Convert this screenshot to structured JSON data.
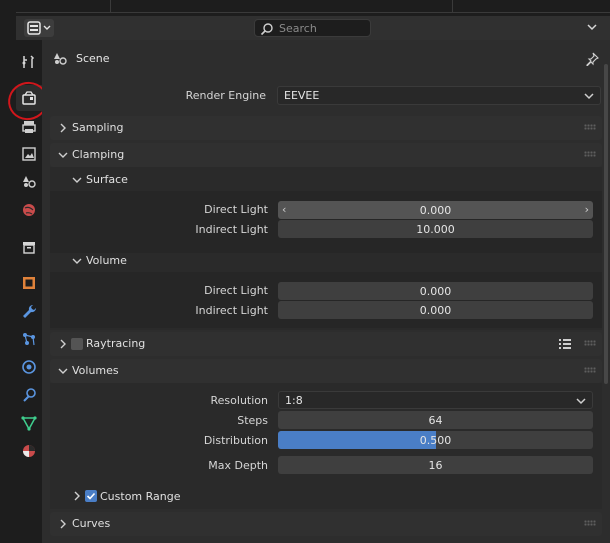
{
  "header": {
    "search_placeholder": "Search",
    "editor_type_icon": "properties-editor-icon"
  },
  "tabs": [
    {
      "name": "tool-icon"
    },
    {
      "name": "render-icon",
      "active": true
    },
    {
      "name": "output-icon"
    },
    {
      "name": "view-layer-icon"
    },
    {
      "name": "scene-icon"
    },
    {
      "name": "world-icon"
    },
    {
      "name": "collection-icon"
    },
    {
      "name": "object-icon"
    },
    {
      "name": "modifier-icon"
    },
    {
      "name": "particles-icon"
    },
    {
      "name": "physics-icon"
    },
    {
      "name": "constraints-icon"
    },
    {
      "name": "data-icon"
    },
    {
      "name": "material-icon"
    }
  ],
  "breadcrumb": {
    "scene": "Scene"
  },
  "render_engine": {
    "label": "Render Engine",
    "value": "EEVEE"
  },
  "panels": {
    "sampling": "Sampling",
    "clamping": "Clamping",
    "surface": "Surface",
    "volume": "Volume",
    "raytracing": "Raytracing",
    "volumes": "Volumes",
    "custom_range": "Custom Range",
    "curves": "Curves"
  },
  "clamping": {
    "surface_direct": {
      "label": "Direct Light",
      "value": "0.000"
    },
    "surface_indirect": {
      "label": "Indirect Light",
      "value": "10.000"
    },
    "volume_direct": {
      "label": "Direct Light",
      "value": "0.000"
    },
    "volume_indirect": {
      "label": "Indirect Light",
      "value": "0.000"
    }
  },
  "volumes": {
    "resolution": {
      "label": "Resolution",
      "value": "1:8"
    },
    "steps": {
      "label": "Steps",
      "value": "64"
    },
    "distribution": {
      "label": "Distribution",
      "value": "0.500",
      "fill_fraction": 0.5
    },
    "max_depth": {
      "label": "Max Depth",
      "value": "16"
    }
  },
  "custom_range_checked": true,
  "raytracing_checked": false,
  "colors": {
    "accent": "#4a7ec6",
    "annotation": "#d1161b"
  }
}
